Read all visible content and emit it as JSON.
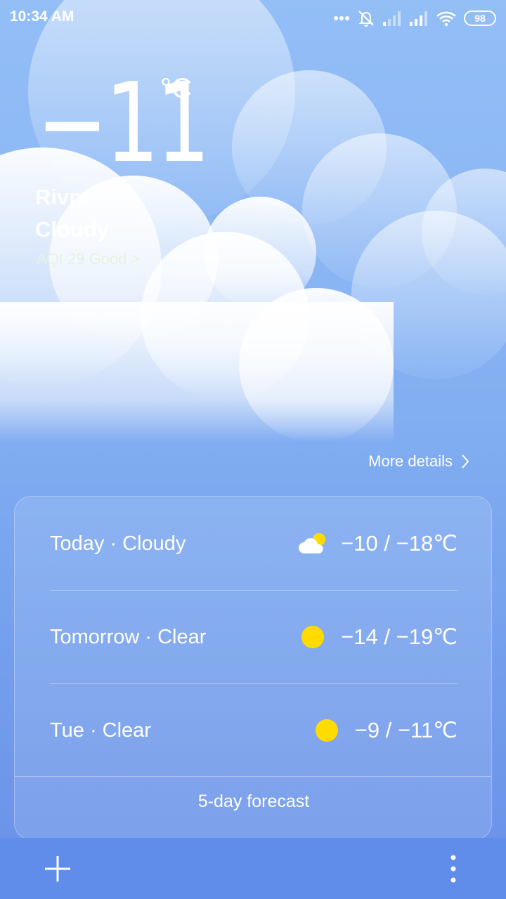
{
  "status_bar": {
    "time": "10:34 AM",
    "battery": "98"
  },
  "current": {
    "temperature": "−11",
    "unit": "°C",
    "city": "Rivne",
    "condition": "Cloudy",
    "aqi": "AQI 29 Good >"
  },
  "more_details": "More details",
  "forecast": {
    "rows": [
      {
        "label": "Today · Cloudy",
        "icon": "partly-cloudy-icon",
        "temps": "−10 / −18℃"
      },
      {
        "label": "Tomorrow · Clear",
        "icon": "sun-icon",
        "temps": "−14 / −19℃"
      },
      {
        "label": "Tue · Clear",
        "icon": "sun-icon",
        "temps": "−9 / −11℃"
      }
    ],
    "link_label": "5-day forecast"
  },
  "colors": {
    "sun": "#ffdb00",
    "bottom_bar": "#608dea"
  }
}
